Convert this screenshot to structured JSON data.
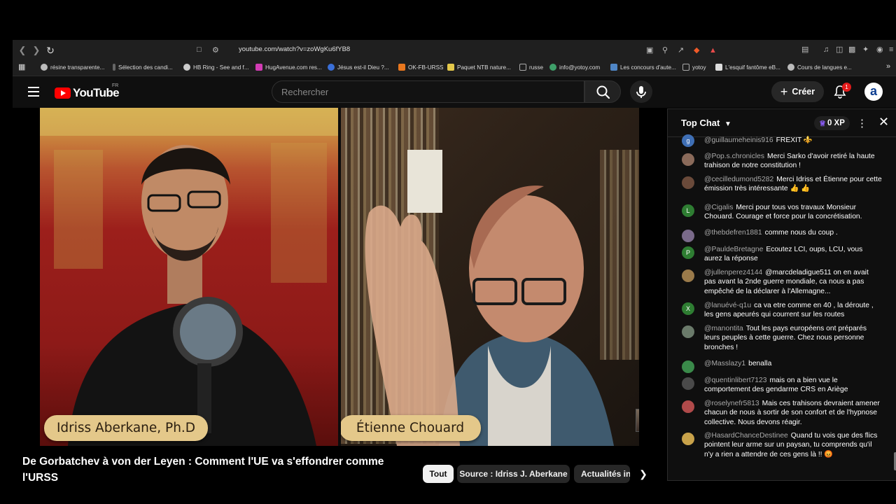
{
  "browser": {
    "url": "youtube.com/watch?v=zoWgKu6fYB8",
    "bookmarks": [
      {
        "label": "résine transparente...",
        "color": "#bbbbbb"
      },
      {
        "label": "Sélection des candi...",
        "color": "#666666"
      },
      {
        "label": "HB Ring - See and f...",
        "color": "#cccccc"
      },
      {
        "label": "HugAvenue.com res...",
        "color": "#d23cb4"
      },
      {
        "label": "Jésus est-il Dieu ?...",
        "color": "#3a6fd8"
      },
      {
        "label": "OK-FB-URSS",
        "color": "#e8771e"
      },
      {
        "label": "Paquet NTB nature...",
        "color": "#e4c84a"
      },
      {
        "label": "russe",
        "color": "#888888"
      },
      {
        "label": "info@yotoy.com",
        "color": "#3fa06a"
      },
      {
        "label": "Les concours d'aute...",
        "color": "#4f86c6"
      },
      {
        "label": "yotoy",
        "color": "#888888"
      },
      {
        "label": "L'esquif fantôme eB...",
        "color": "#dddddd"
      },
      {
        "label": "Cours de langues e...",
        "color": "#bbbbbb"
      }
    ]
  },
  "youtube": {
    "logo_text": "YouTube",
    "region": "FR",
    "search_placeholder": "Rechercher",
    "create_label": "Créer",
    "notification_count": "1",
    "avatar_letter": "a"
  },
  "video": {
    "left_name": "Idriss Aberkane, Ph.D",
    "right_name": "Étienne Chouard",
    "title": "De Gorbatchev à von der Leyen : Comment l'UE va s'effondrer comme l'URSS"
  },
  "chips": [
    {
      "label": "Tout",
      "active": true
    },
    {
      "label": "Source : Idriss J. Aberkane",
      "active": false
    },
    {
      "label": "Actualités in",
      "active": false
    }
  ],
  "chat": {
    "header": "Top Chat",
    "xp": "0 XP",
    "messages": [
      {
        "user": "@guillaumeheinis916",
        "text": "FREXIT ⚜️",
        "avatar": "g",
        "color": "#3f6fb5"
      },
      {
        "user": "@Pop.s.chronicles",
        "text": "Merci Sarko d'avoir retiré la haute trahison de notre constitution !",
        "avatar": "",
        "color": "#8a6a5a"
      },
      {
        "user": "@cecilledumond5282",
        "text": "Merci Idriss et Étienne pour cette émission très intéressante 👍 👍",
        "avatar": "",
        "color": "#6a4a3a"
      },
      {
        "user": "@Cigalis",
        "text": "Merci pour tous vos travaux Monsieur Chouard. Courage et force pour la concrétisation.",
        "avatar": "L",
        "color": "#2e7d32"
      },
      {
        "user": "@thebdefren1881",
        "text": "comme nous du coup .",
        "avatar": "",
        "color": "#7a6a8a"
      },
      {
        "user": "@PauldeBretagne",
        "text": "Ecoutez LCI, oups, LCU, vous aurez la réponse",
        "avatar": "P",
        "color": "#2e7d32"
      },
      {
        "user": "@jullenperez4144",
        "text": "@marcdeladigue511 on en avait pas avant la 2nde guerre mondiale, ca nous a pas empêché de la déclarer à l'Allemagne...",
        "avatar": "",
        "color": "#9a7a4a"
      },
      {
        "user": "@lanuévé-q1u",
        "text": "ca va etre comme en 40 , la déroute , les gens apeurés qui courrent sur les routes",
        "avatar": "X",
        "color": "#2e7d32"
      },
      {
        "user": "@manontita",
        "text": "Tout les pays européens ont préparés leurs peuples à cette guerre. Chez nous personne bronches !",
        "avatar": "",
        "color": "#6a7a6a"
      },
      {
        "user": "@Masslazy1",
        "text": "benalla",
        "avatar": "",
        "color": "#3a8a4a"
      },
      {
        "user": "@quentinlibert7123",
        "text": "mais on a bien vue le comportement des gendarme CRS en Ariège",
        "avatar": "",
        "color": "#4a4a4a"
      },
      {
        "user": "@roselynefr5813",
        "text": "Mais ces trahisons devraient amener chacun de nous à sortir de son confort et de l'hypnose collective. Nous devons réagir.",
        "avatar": "",
        "color": "#b04a4a"
      },
      {
        "user": "@HasardChanceDestinee",
        "text": "Quand tu vois que des flics pointent leur arme sur un paysan, tu comprends qu'il n'y a rien a attendre de ces gens là !! 😡",
        "avatar": "",
        "color": "#c8a24a"
      }
    ]
  }
}
